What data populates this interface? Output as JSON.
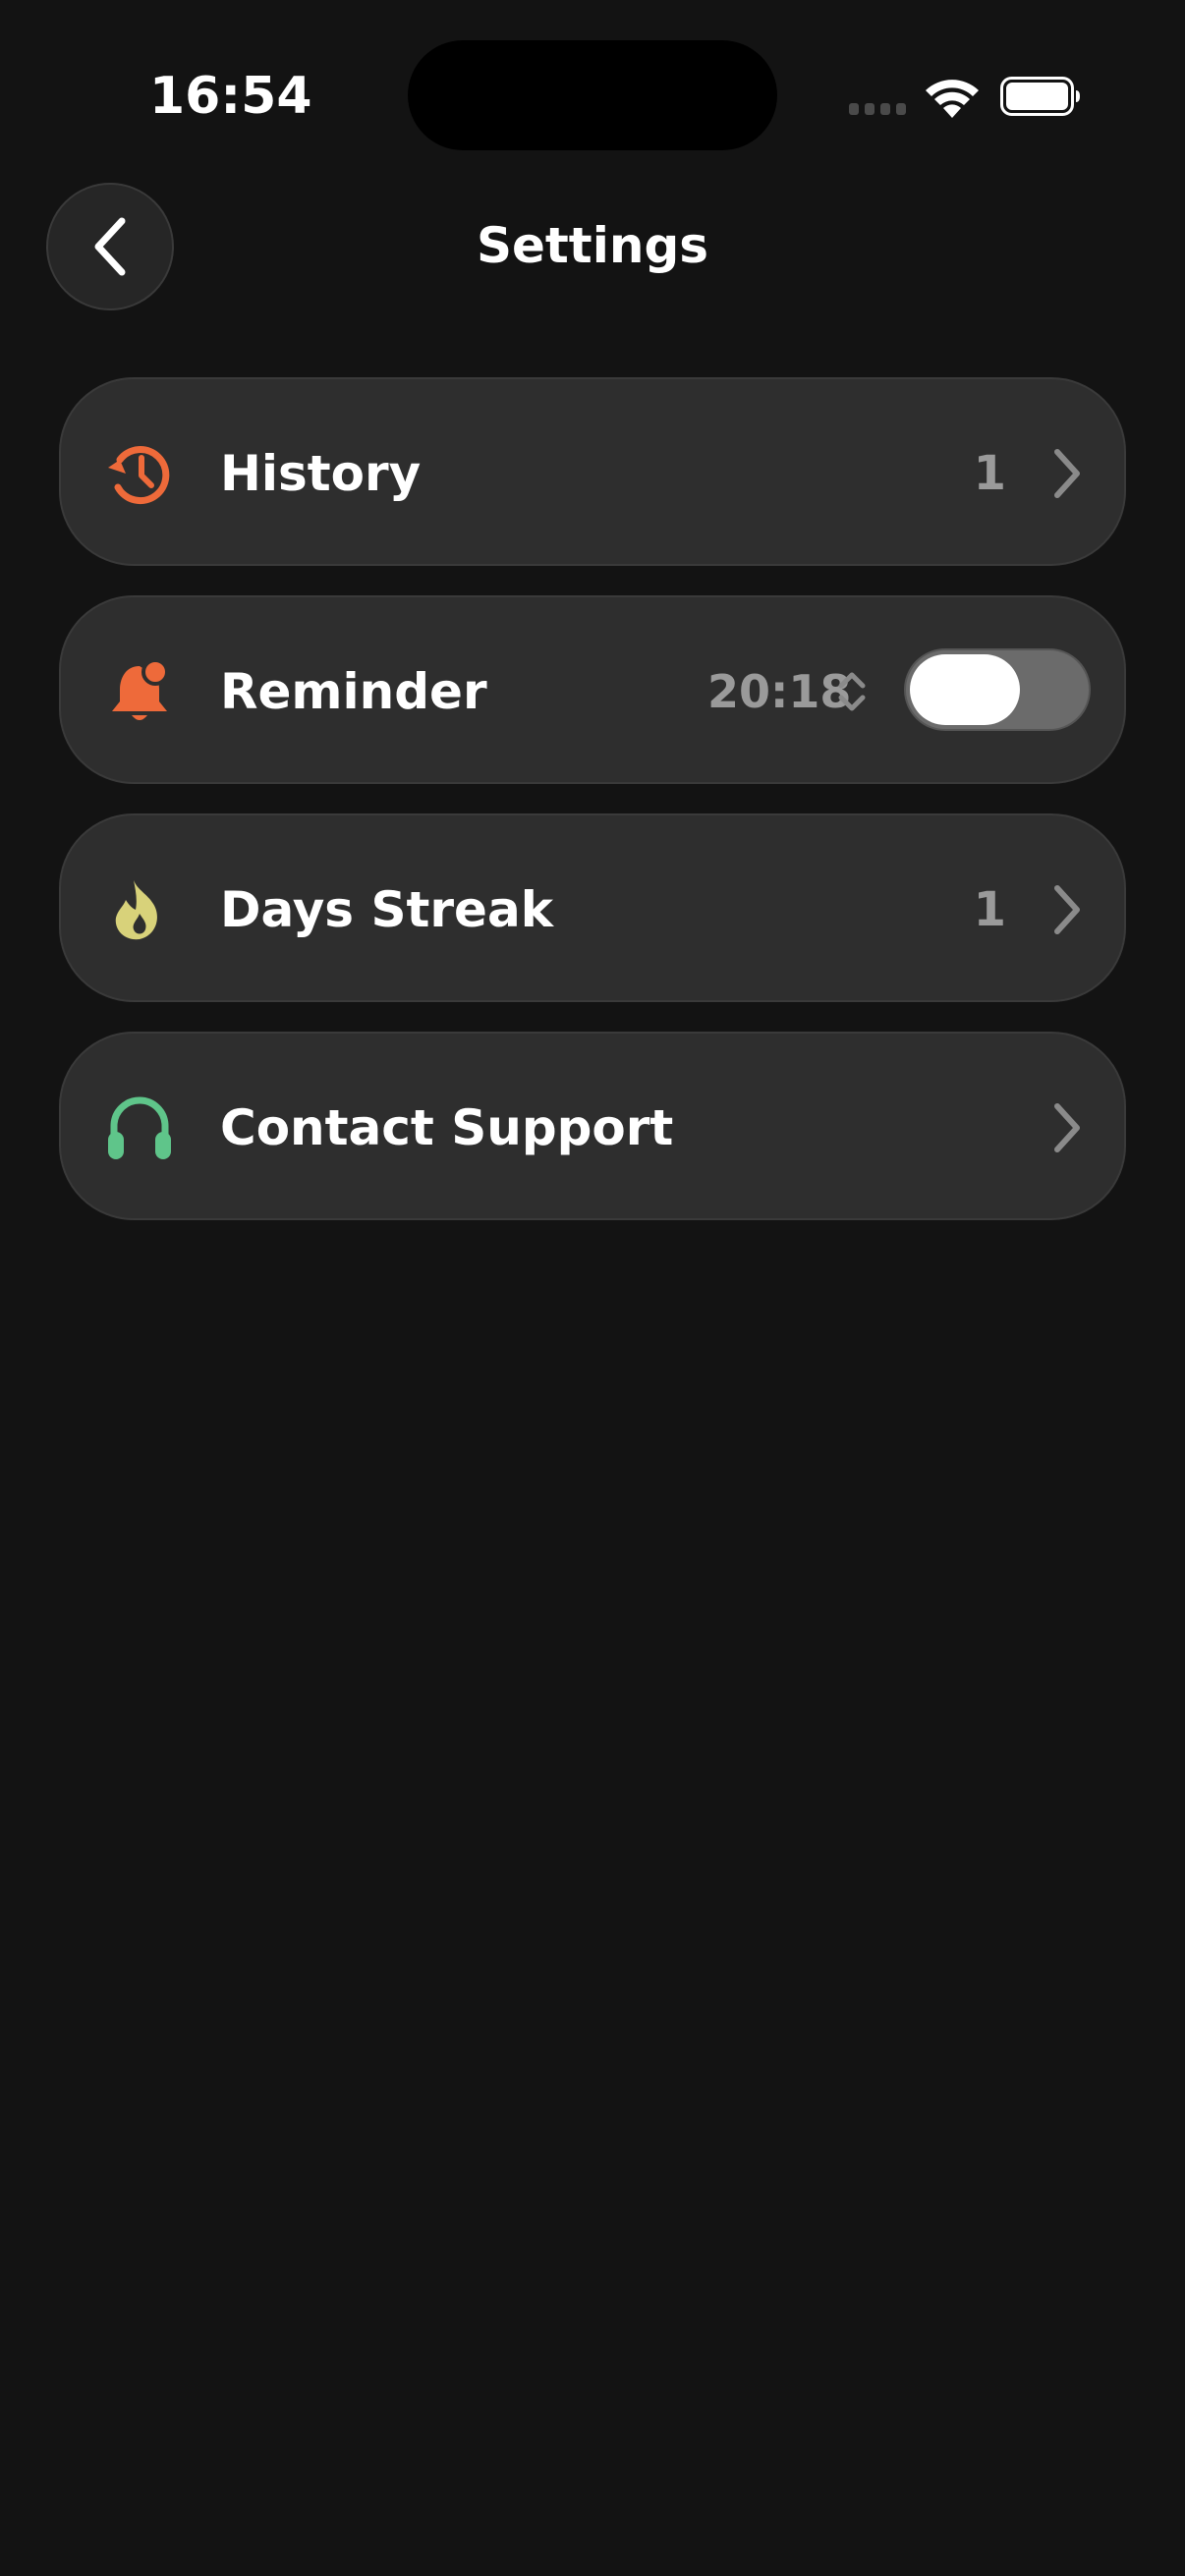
{
  "status_bar": {
    "time": "16:54"
  },
  "header": {
    "title": "Settings",
    "back_icon": "chevron-left-icon"
  },
  "rows": [
    {
      "label": "History",
      "count": "1",
      "icon": "history-icon",
      "icon_color": "#ee6a3a"
    },
    {
      "label": "Reminder",
      "time": "20:18",
      "toggle_on": false,
      "icon": "bell-icon",
      "icon_color": "#ee6a3a"
    },
    {
      "label": "Days Streak",
      "count": "1",
      "icon": "flame-icon",
      "icon_color": "#d8d27a"
    },
    {
      "label": "Contact Support",
      "icon": "headphones-icon",
      "icon_color": "#5fc58a"
    }
  ],
  "colors": {
    "background": "#131313",
    "row_background": "#2e2e2e",
    "secondary_text": "#9a9a9a"
  }
}
